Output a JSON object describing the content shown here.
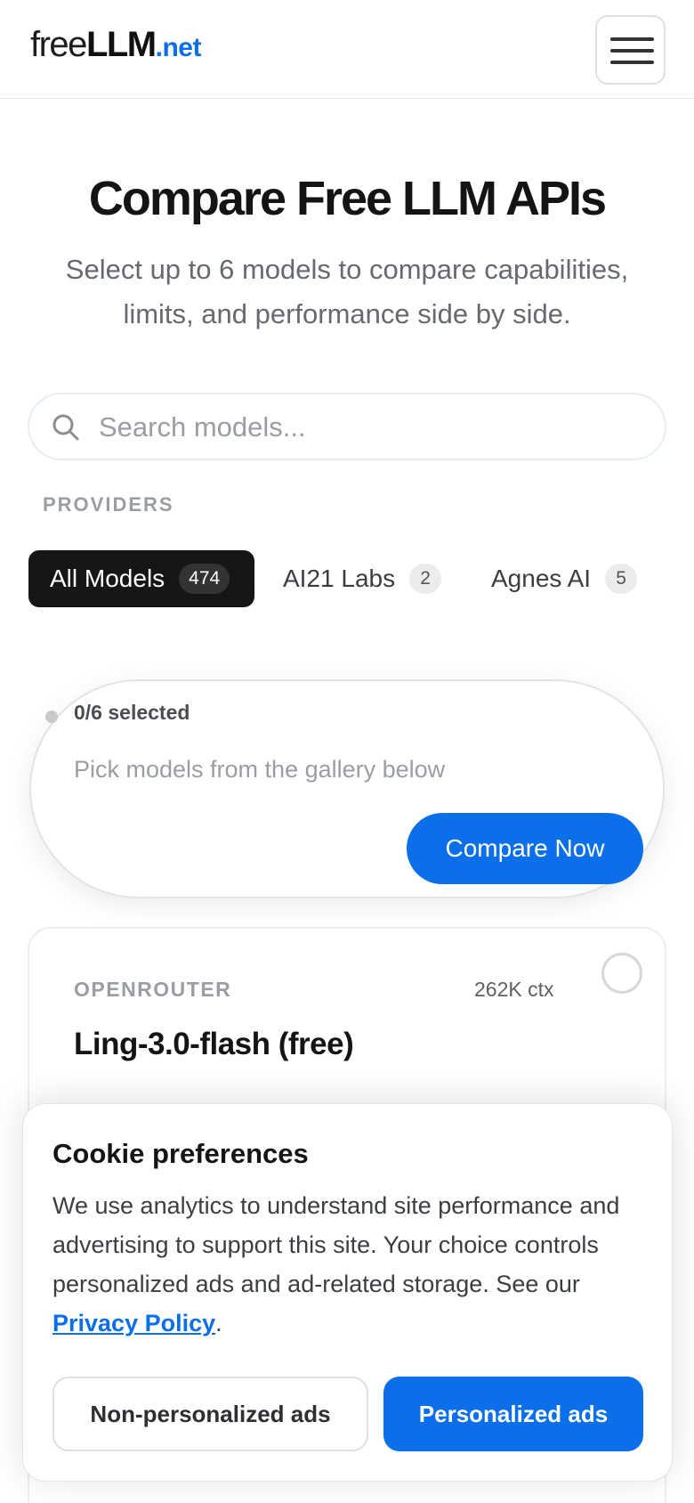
{
  "header": {
    "logo_pre": "free",
    "logo_mid": "LLM",
    "logo_tld": ".net",
    "menu_icon": "hamburger-icon"
  },
  "hero": {
    "title": "Compare Free LLM APIs",
    "subtitle": "Select up to 6 models to compare capabilities, limits, and performance side by side."
  },
  "search": {
    "placeholder": "Search models...",
    "value": "",
    "icon": "search-icon"
  },
  "providers": {
    "label": "PROVIDERS",
    "chips": [
      {
        "label": "All Models",
        "count": "474",
        "active": true
      },
      {
        "label": "AI21 Labs",
        "count": "2",
        "active": false
      },
      {
        "label": "Agnes AI",
        "count": "5",
        "active": false
      }
    ]
  },
  "selection": {
    "status": "0/6 selected",
    "hint": "Pick models from the gallery below",
    "compare_label": "Compare Now"
  },
  "card": {
    "provider": "OPENROUTER",
    "context": "262K ctx",
    "name": "Ling-3.0-flash (free)"
  },
  "cookie": {
    "title": "Cookie preferences",
    "body": "We use analytics to understand site performance and advertising to support this site. Your choice controls personalized ads and ad-related storage. See our ",
    "link": "Privacy Policy",
    "body_end": ".",
    "button_non_personalized": "Non-personalized ads",
    "button_personalized": "Personalized ads"
  },
  "colors": {
    "accent": "#0a6fe8",
    "chip_active_bg": "#161616",
    "muted_text": "#9a9da3"
  }
}
